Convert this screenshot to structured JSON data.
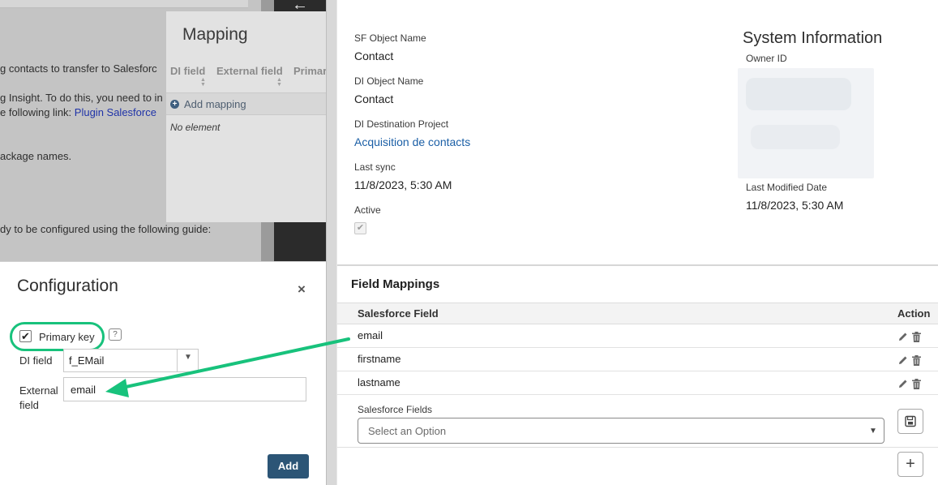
{
  "background": {
    "lines": [
      "g contacts to transfer to Salesforc",
      "g Insight. To do this, you need to in",
      "e following link: ",
      "ackage names.",
      "dy to be configured using the following guide:"
    ],
    "link_text": "Plugin Salesforce"
  },
  "mapping_panel": {
    "title": "Mapping",
    "columns": [
      "DI field",
      "External field",
      "Primar"
    ],
    "add_label": "Add mapping",
    "empty_text": "No element"
  },
  "configuration": {
    "title": "Configuration",
    "close_symbol": "×",
    "primary_key_label": "Primary key",
    "primary_key_checked": true,
    "help_symbol": "?",
    "di_field_label": "DI field",
    "di_field_value": "f_EMail",
    "external_field_label": "External field",
    "external_field_value": "email",
    "add_button": "Add"
  },
  "details": {
    "sf_object_label": "SF Object Name",
    "sf_object_value": "Contact",
    "di_object_label": "DI Object Name",
    "di_object_value": "Contact",
    "di_dest_label": "DI Destination Project",
    "di_dest_value": "Acquisition de contacts",
    "last_sync_label": "Last sync",
    "last_sync_value": "11/8/2023, 5:30 AM",
    "active_label": "Active",
    "active_checked": true
  },
  "system_info": {
    "title": "System Information",
    "owner_label": "Owner ID",
    "last_modified_label": "Last Modified Date",
    "last_modified_value": "11/8/2023, 5:30 AM"
  },
  "field_mappings": {
    "title": "Field Mappings",
    "col_field": "Salesforce Field",
    "col_action": "Action",
    "rows": [
      "email",
      "firstname",
      "lastname"
    ],
    "select_label": "Salesforce Fields",
    "select_placeholder": "Select an Option"
  },
  "colors": {
    "highlight": "#18c27c",
    "primary_button": "#2c5576",
    "link": "#1b5fa6"
  }
}
